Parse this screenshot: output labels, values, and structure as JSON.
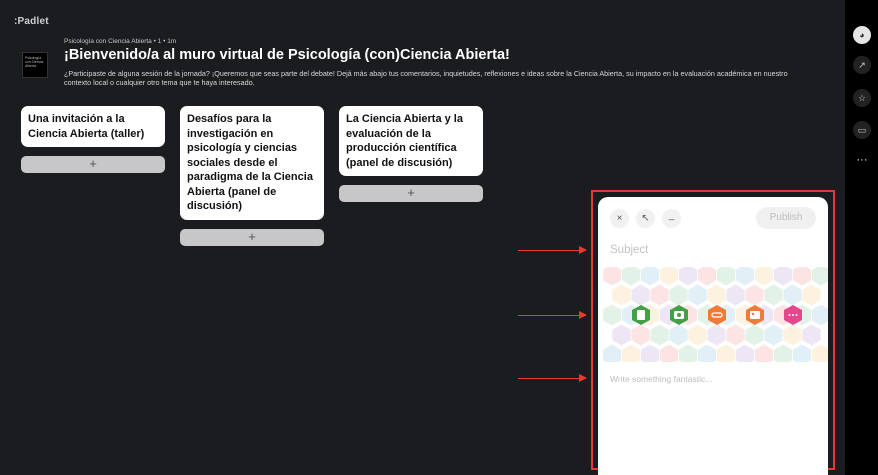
{
  "app": {
    "brand": ":Padlet"
  },
  "header": {
    "meta": "Psicología con Ciencia Abierta • 1 • 1m",
    "title": "¡Bienvenido/a al muro virtual de Psicología (con)Ciencia Abierta!",
    "description": "¿Participaste de alguna sesión de la jornada? ¡Queremos que seas parte del debate! Dejá más abajo tus comentarios, inquietudes, reflexiones e ideas sobre la Ciencia Abierta, su impacto en la evaluación académica en nuestro contexto local o cualquier otro tema que te haya interesado.",
    "thumbnail_text": "Psicología con Ciencia Abierta"
  },
  "columns": [
    {
      "title": "Una invitación a la Ciencia Abierta (taller)",
      "add_label": "+"
    },
    {
      "title": "Desafíos para la investigación en psicología y ciencias sociales desde el paradigma de la Ciencia Abierta (panel de discusión)",
      "add_label": "+"
    },
    {
      "title": "La Ciencia Abierta y la evaluación de la producción científica (panel de discusión)",
      "add_label": "+"
    }
  ],
  "composer": {
    "close_icon": "×",
    "expand_icon": "↖",
    "minimize_icon": "_",
    "publish_label": "Publish",
    "subject_placeholder": "Subject",
    "body_placeholder": "Write something fantastic...",
    "attachments": [
      {
        "icon": "file-upload-icon",
        "color": "#43a047"
      },
      {
        "icon": "camera-icon",
        "color": "#43a047"
      },
      {
        "icon": "link-icon",
        "color": "#f07a3a"
      },
      {
        "icon": "image-search-icon",
        "color": "#f07a3a"
      },
      {
        "icon": "more-icon",
        "color": "#e8468c"
      }
    ]
  },
  "right_rail": {
    "more_label": "···"
  },
  "colors": {
    "background": "#1b1c1f",
    "highlight": "#e53935"
  }
}
